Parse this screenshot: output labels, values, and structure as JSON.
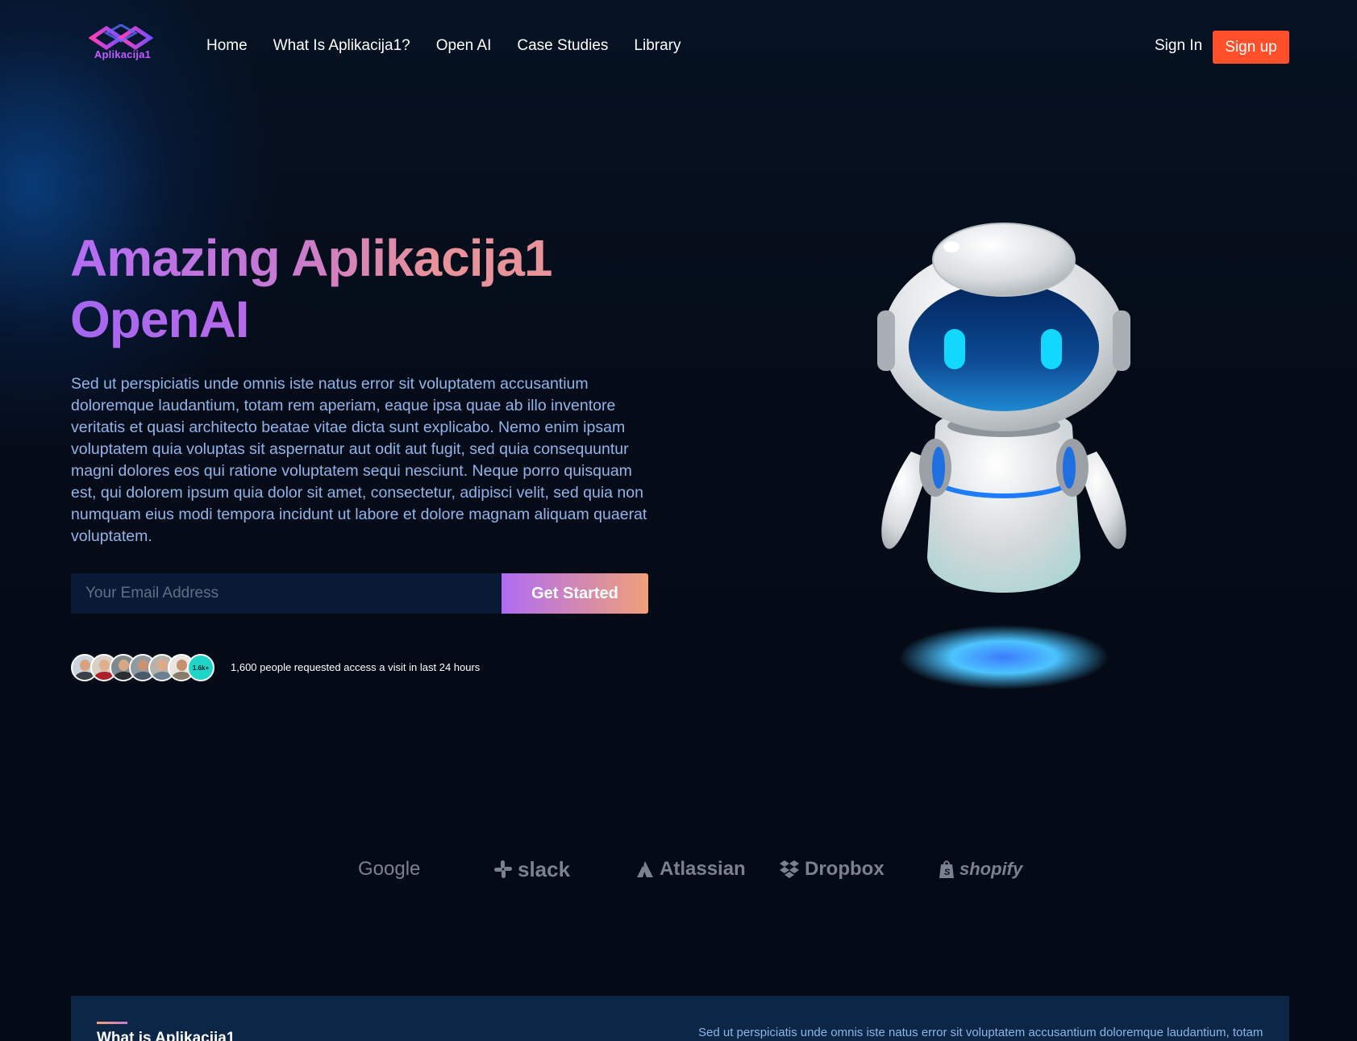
{
  "brand": {
    "name": "Aplikacija1",
    "logo_icon": "interlocked-diamonds-logo"
  },
  "nav": {
    "links": [
      "Home",
      "What Is Aplikacija1?",
      "Open AI",
      "Case Studies",
      "Library"
    ],
    "sign_in": "Sign In",
    "sign_up": "Sign up"
  },
  "hero": {
    "title_line1": "Amazing Aplikacija1",
    "title_line2": "OpenAI",
    "description": "Sed ut perspiciatis unde omnis iste natus error sit voluptatem accusantium doloremque laudantium, totam rem aperiam, eaque ipsa quae ab illo inventore veritatis et quasi architecto beatae vitae dicta sunt explicabo. Nemo enim ipsam voluptatem quia voluptas sit aspernatur aut odit aut fugit, sed quia consequuntur magni dolores eos qui ratione voluptatem sequi nesciunt. Neque porro quisquam est, qui dolorem ipsum quia dolor sit amet, consectetur, adipisci velit, sed quia non numquam eius modi tempora incidunt ut labore et dolore magnam aliquam quaerat voluptatem.",
    "email_placeholder": "Your Email Address",
    "email_value": "",
    "cta": "Get Started",
    "avatar_count": "1.6k+",
    "access_text": "1,600 people requested access a visit in last 24 hours",
    "illustration": "robot-illustration"
  },
  "brands": [
    "Google",
    "slack",
    "Atlassian",
    "Dropbox",
    "shopify"
  ],
  "about": {
    "title": "What is Aplikacija1",
    "text": "Sed ut perspiciatis unde omnis iste natus error sit voluptatem accusantium doloremque laudantium, totam"
  },
  "colors": {
    "accent": "#ff4f2b",
    "gradient_start": "#b06cf3",
    "gradient_end": "#f0a078",
    "background": "#050b17",
    "body_text": "#8fb4e8"
  }
}
